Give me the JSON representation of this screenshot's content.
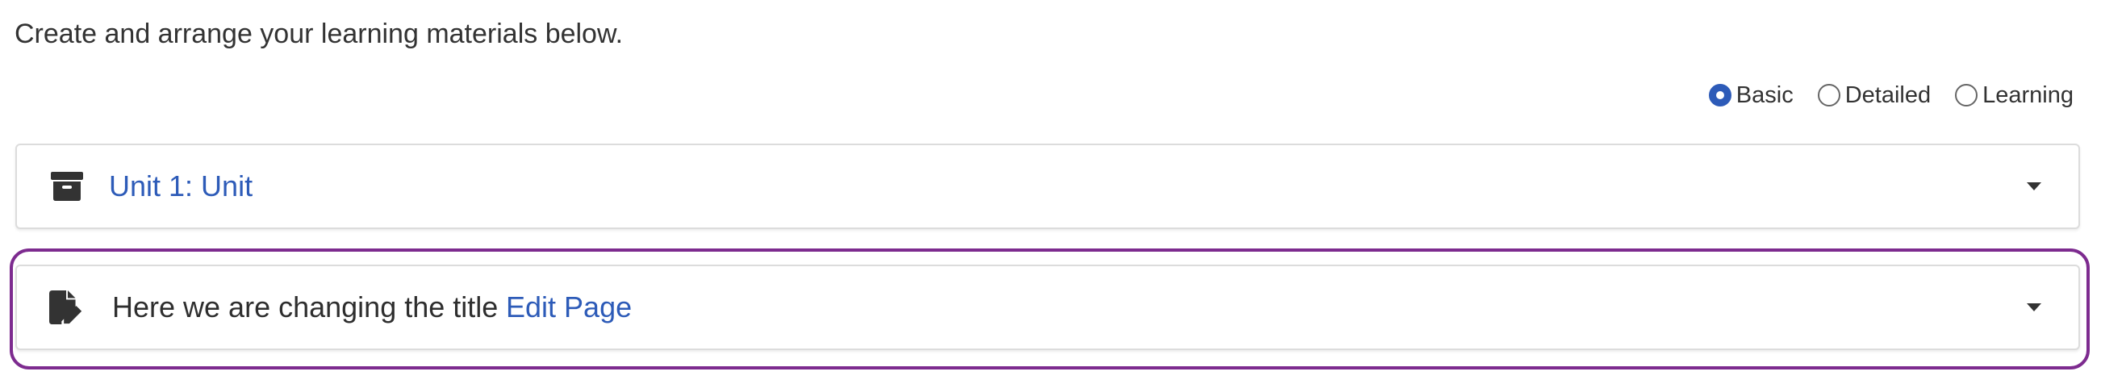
{
  "intro_text": "Create and arrange your learning materials below.",
  "view_mode": {
    "options": [
      {
        "label": "Basic",
        "selected": true
      },
      {
        "label": "Detailed",
        "selected": false
      },
      {
        "label": "Learning",
        "selected": false
      }
    ]
  },
  "items": [
    {
      "icon": "archive-box-icon",
      "title": "Unit 1: Unit",
      "title_is_link": true
    },
    {
      "icon": "file-edit-icon",
      "title": "Here we are changing the title",
      "action_label": "Edit Page",
      "selected": true
    }
  ],
  "colors": {
    "link": "#2d5bb8",
    "selected_outline": "#7d2b8f",
    "radio_selected": "#2d5bb8"
  }
}
